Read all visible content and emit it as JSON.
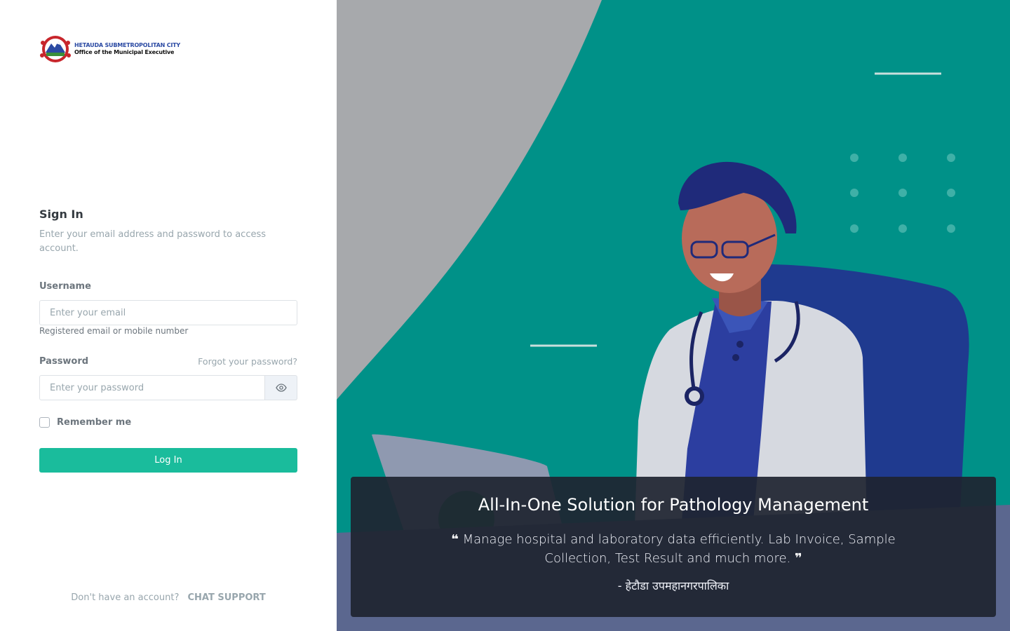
{
  "brand": {
    "logo_line1": "HETAUDA SUBMETROPOLITAN CITY",
    "logo_line2": "Office of the Municipal Executive"
  },
  "signin": {
    "title": "Sign In",
    "subtitle": "Enter your email address and password to access account."
  },
  "form": {
    "username_label": "Username",
    "username_placeholder": "Enter your email",
    "username_value": "",
    "username_help": "Registered email or mobile number",
    "password_label": "Password",
    "forgot_label": "Forgot your password?",
    "password_placeholder": "Enter your password",
    "password_value": "",
    "remember_label": "Remember me",
    "remember_checked": false,
    "login_label": "Log In"
  },
  "footer": {
    "prompt": "Don't have an account?",
    "support_label": "CHAT SUPPORT"
  },
  "hero": {
    "title": "All-In-One Solution for Pathology Management",
    "quote": "Manage hospital and laboratory data efficiently. Lab Invoice, Sample Collection, Test Result and much more.",
    "author": "- हेटौडा उपमहानगरपालिका"
  },
  "colors": {
    "primary": "#1abc9c",
    "hero_bg": "#009188",
    "overlay": "#1e2430",
    "muted_text": "#98a6ad"
  },
  "icons": [
    "eye-icon",
    "open-quote-icon",
    "close-quote-icon",
    "municipal-emblem-icon"
  ]
}
